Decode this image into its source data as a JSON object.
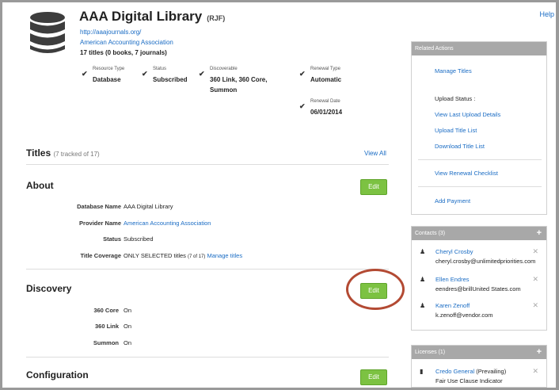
{
  "header": {
    "title": "AAA Digital Library",
    "code": "(RJF)",
    "url": "http://aaajournals.org/",
    "provider": "American Accounting Association",
    "count": "17 titles (0 books, 7 journals)",
    "help": "Help"
  },
  "attributes": [
    {
      "label": "Resource Type",
      "value": "Database"
    },
    {
      "label": "Status",
      "value": "Subscribed"
    },
    {
      "label": "Discoverable",
      "value": "360 Link, 360 Core,",
      "value2": "Summon"
    },
    {
      "label": "Renewal Type",
      "value": "Automatic"
    },
    {
      "label": "Renewal Date",
      "value": "06/01/2014"
    }
  ],
  "titles_section": {
    "heading": "Titles",
    "sub": "(7 tracked of 17)",
    "view_all": "View All"
  },
  "about": {
    "heading": "About",
    "edit": "Edit",
    "rows": [
      {
        "key": "Database Name",
        "value": "AAA Digital Library"
      },
      {
        "key": "Provider Name",
        "value": "American Accounting Association"
      },
      {
        "key": "Status",
        "value": "Subscribed"
      },
      {
        "key": "Title Coverage",
        "value": "ONLY SELECTED titles",
        "value_small": "(7 of 17)",
        "link": "Manage titles"
      }
    ]
  },
  "discovery": {
    "heading": "Discovery",
    "edit": "Edit",
    "rows": [
      {
        "key": "360 Core",
        "value": "On"
      },
      {
        "key": "360 Link",
        "value": "On"
      },
      {
        "key": "Summon",
        "value": "On"
      }
    ]
  },
  "configuration": {
    "heading": "Configuration",
    "edit": "Edit"
  },
  "related_actions": {
    "header": "Related Actions",
    "manage_titles": "Manage Titles",
    "upload_status": "Upload Status :",
    "view_last_upload": "View Last Upload Details",
    "upload_title_list": "Upload Title List",
    "download_title_list": "Download Title List",
    "view_renewal_checklist": "View Renewal Checklist",
    "add_payment": "Add Payment"
  },
  "contacts": {
    "header": "Contacts (3)",
    "items": [
      {
        "name": "Cheryl Crosby",
        "email": "cheryl.crosby@unlimitedpriorities.com"
      },
      {
        "name": "Ellen Endres",
        "email": "eendres@brillUnited States.com"
      },
      {
        "name": "Karen Zenoff",
        "email": "k.zenoff@vendor.com"
      }
    ]
  },
  "licenses": {
    "header": "Licenses (1)",
    "items": [
      {
        "name": "Credo General",
        "tag": "(Prevailing)",
        "detail": "Fair Use Clause Indicator"
      }
    ]
  },
  "colors": {
    "accent": "#1a6cc4",
    "edit_button": "#7cc242",
    "highlight_circle": "#b34a33",
    "panel_header": "#a8a8a8"
  }
}
